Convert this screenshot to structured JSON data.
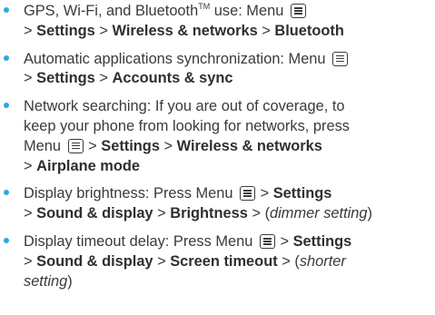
{
  "items": [
    {
      "lead": "GPS, Wi-Fi, and Bluetooth",
      "tm": "TM",
      "after_tm": " use: Menu",
      "sep": ">",
      "path": [
        "Settings",
        "Wireless & networks",
        "Bluetooth"
      ]
    },
    {
      "lead": "Automatic applications synchronization: Menu",
      "sep": ">",
      "path": [
        "Settings",
        "Accounts & sync"
      ]
    },
    {
      "line1": "Network searching: If you are out of coverage, to",
      "line2": "keep your phone from looking for networks, press",
      "lead": "Menu",
      "sep": ">",
      "path": [
        "Settings",
        "Wireless & networks",
        "Airplane mode"
      ]
    },
    {
      "lead": "Display brightness: Press Menu",
      "sep": ">",
      "path": [
        "Settings",
        "Sound & display",
        "Brightness"
      ],
      "note": "dimmer setting"
    },
    {
      "lead": "Display timeout delay: Press Menu",
      "sep": ">",
      "path": [
        "Settings",
        "Sound & display",
        "Screen timeout"
      ],
      "note_part1": "shorter",
      "note_part2": "setting"
    }
  ],
  "colors": {
    "bullet": "#2aa9e0",
    "text": "#3a3a3a"
  },
  "icons": {
    "menu": "menu-key-icon",
    "bullet": "bullet-dot"
  }
}
